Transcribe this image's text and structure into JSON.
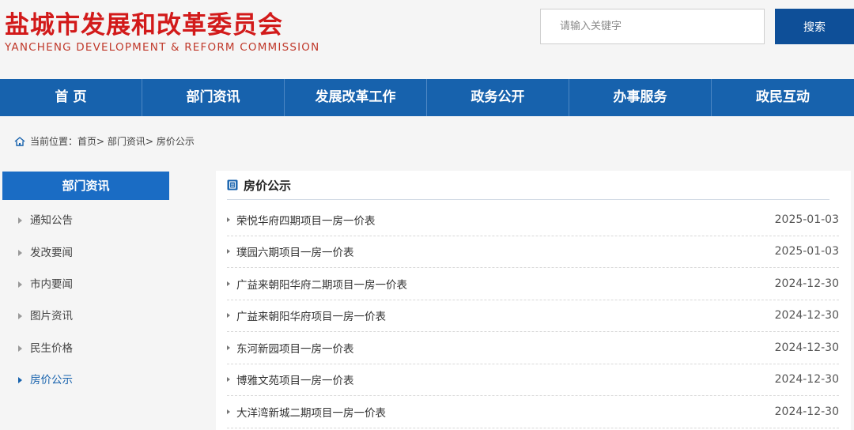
{
  "header": {
    "title_cn": "盐城市发展和改革委员会",
    "title_en": "YANCHENG DEVELOPMENT & REFORM COMMISSION",
    "search_placeholder": "请输入关键字",
    "search_button": "搜索"
  },
  "nav": {
    "items": [
      "首 页",
      "部门资讯",
      "发展改革工作",
      "政务公开",
      "办事服务",
      "政民互动"
    ]
  },
  "breadcrumb": {
    "prefix": "当前位置：",
    "items": [
      "首页",
      "部门资讯",
      "房价公示"
    ],
    "separator": ">"
  },
  "sidebar": {
    "title": "部门资讯",
    "items": [
      {
        "label": "通知公告",
        "active": false
      },
      {
        "label": "发改要闻",
        "active": false
      },
      {
        "label": "市内要闻",
        "active": false
      },
      {
        "label": "图片资讯",
        "active": false
      },
      {
        "label": "民生价格",
        "active": false
      },
      {
        "label": "房价公示",
        "active": true
      }
    ]
  },
  "main": {
    "title": "房价公示",
    "rows": [
      {
        "title": "荣悦华府四期项目一房一价表",
        "date": "2025-01-03"
      },
      {
        "title": "璞园六期项目一房一价表",
        "date": "2025-01-03"
      },
      {
        "title": "广益来朝阳华府二期项目一房一价表",
        "date": "2024-12-30"
      },
      {
        "title": "广益来朝阳华府项目一房一价表",
        "date": "2024-12-30"
      },
      {
        "title": "东河新园项目一房一价表",
        "date": "2024-12-30"
      },
      {
        "title": "博雅文苑项目一房一价表",
        "date": "2024-12-30"
      },
      {
        "title": "大洋湾新城二期项目一房一价表",
        "date": "2024-12-30"
      }
    ]
  },
  "colors": {
    "brand_red": "#d21a1a",
    "nav_blue": "#1762ad",
    "button_blue": "#0e4f98",
    "side_title_blue": "#1a6cc4"
  }
}
